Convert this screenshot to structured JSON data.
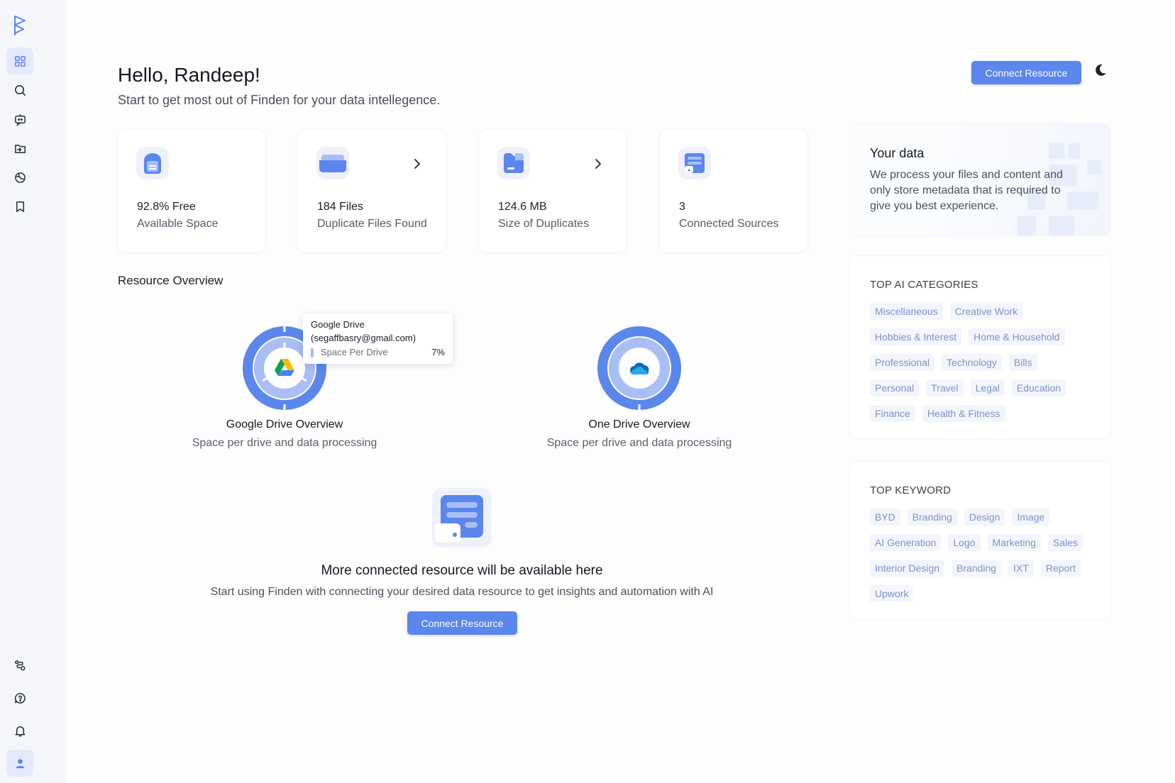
{
  "header": {
    "greeting": "Hello, Randeep!",
    "subtitle": "Start to get most out of Finden for your data intellegence.",
    "connect_label": "Connect Resource"
  },
  "sidebar": {
    "top_items": [
      "dashboard",
      "search",
      "assistant",
      "files",
      "globe",
      "bookmarks"
    ],
    "bottom_items": [
      "integrations",
      "help",
      "notifications",
      "profile"
    ]
  },
  "stats": [
    {
      "value": "92.8% Free",
      "label": "Available Space"
    },
    {
      "value": "184 Files",
      "label": "Duplicate Files Found"
    },
    {
      "value": "124.6 MB",
      "label": "Size of Duplicates"
    },
    {
      "value": "3",
      "label": "Connected Sources"
    }
  ],
  "resource_overview": {
    "title": "Resource Overview",
    "drives": [
      {
        "title": "Google Drive Overview",
        "subtitle": "Space per drive and data processing",
        "usage_percent": 7
      },
      {
        "title": "One Drive Overview",
        "subtitle": "Space per drive and data processing"
      }
    ],
    "tooltip": {
      "title": "Google Drive",
      "account": "(segaffbasry@gmail.com)",
      "series": "Space Per Drive",
      "value": "7%"
    }
  },
  "empty_state": {
    "title": "More connected resource will be available here",
    "subtitle": "Start using Finden with connecting your desired data resource to get insights and automation with AI",
    "button_label": "Connect Resource"
  },
  "your_data": {
    "title": "Your data",
    "text": "We process your files and content and only store metadata that is required to give you best experience."
  },
  "top_ai_categories": {
    "title": "TOP AI CATEGORIES",
    "chips": [
      "Miscellaneous",
      "Creative Work",
      "Hobbies & Interest",
      "Home & Household",
      "Professional",
      "Technology",
      "Bills",
      "Personal",
      "Travel",
      "Legal",
      "Education",
      "Finance",
      "Health & Fitness"
    ]
  },
  "top_keyword": {
    "title": "TOP KEYWORD",
    "chips": [
      "BYD",
      "Branding",
      "Design",
      "Image",
      "AI Generation",
      "Logo",
      "Marketing",
      "Sales",
      "Interior Design",
      "Branding",
      "IXT",
      "Report",
      "Upwork"
    ]
  },
  "colors": {
    "accent": "#5b86ec",
    "chip_text": "#7c93c7",
    "chip_bg": "#f3f5fb",
    "sidebar_bg": "#f5f6fa"
  }
}
